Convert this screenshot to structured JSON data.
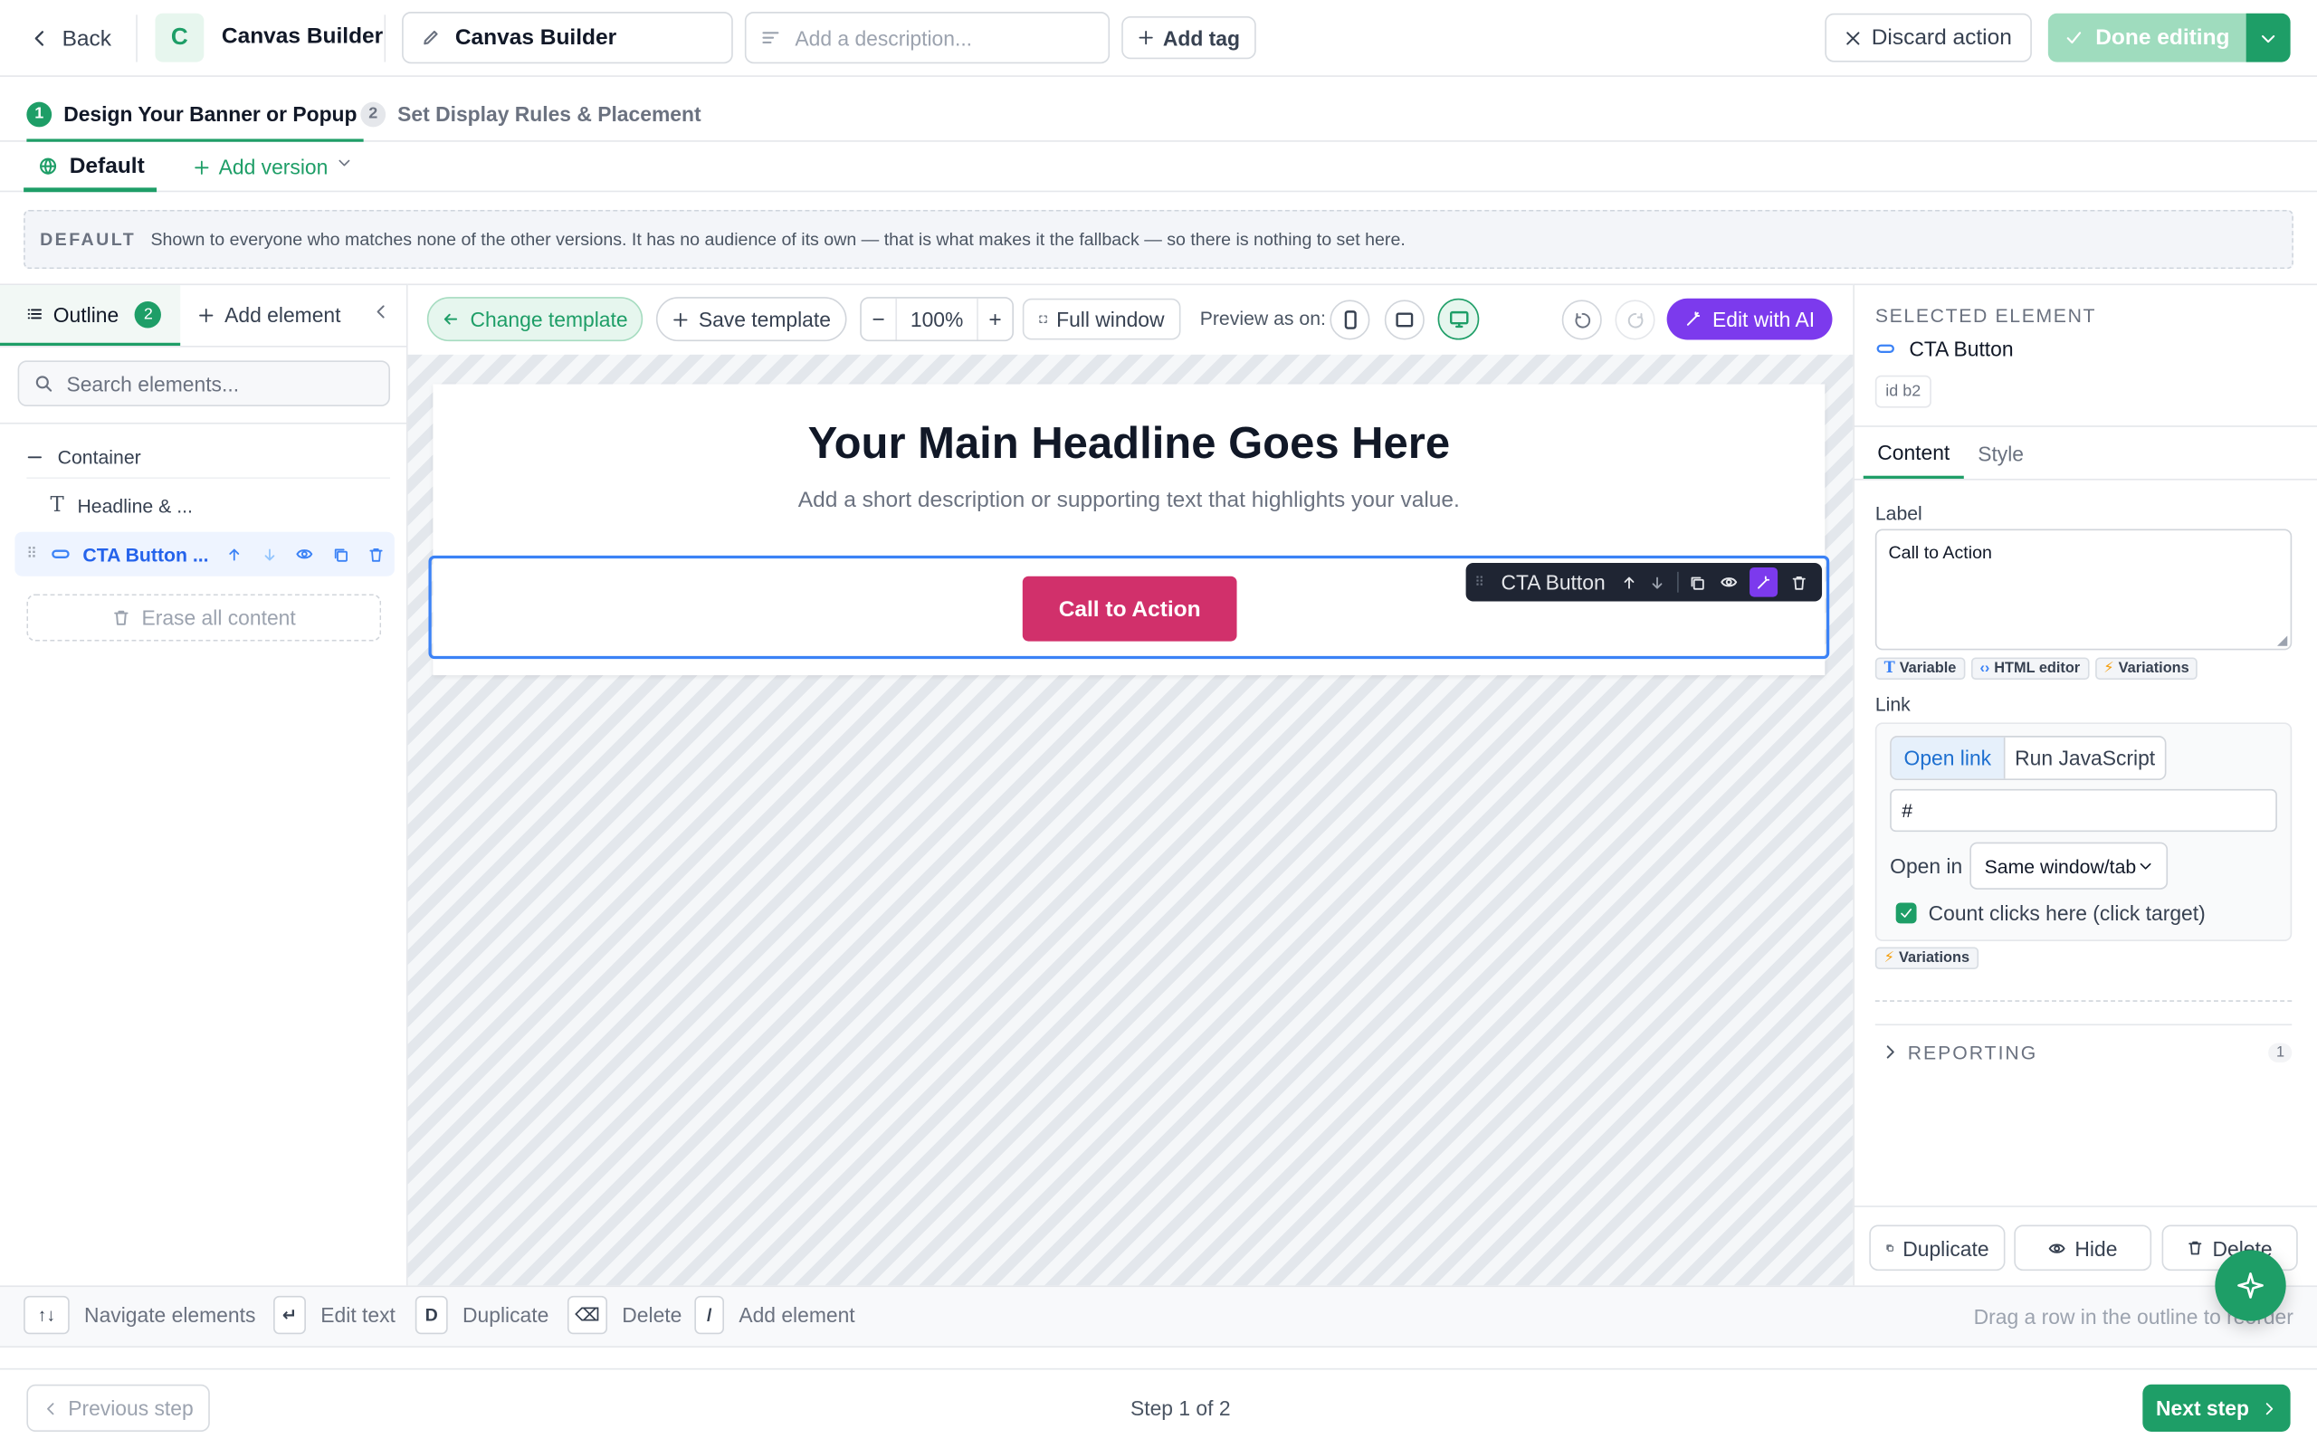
{
  "topbar": {
    "back_label": "Back",
    "app_initial": "C",
    "app_name": "Canvas Builder",
    "title_value": "Canvas Builder",
    "description_placeholder": "Add a description...",
    "add_tag_label": "Add tag",
    "discard_label": "Discard action",
    "done_label": "Done editing"
  },
  "steps": [
    {
      "number": "1",
      "label": "Design Your Banner or Popup",
      "active": true
    },
    {
      "number": "2",
      "label": "Set Display Rules & Placement",
      "active": false
    }
  ],
  "versions": {
    "default_label": "Default",
    "add_label": "Add version"
  },
  "default_banner": {
    "tag": "DEFAULT",
    "text": "Shown to everyone who matches none of the other versions. It has no audience of its own — that is what makes it the fallback — so there is nothing to set here."
  },
  "left_panel": {
    "outline_label": "Outline",
    "outline_count": "2",
    "add_element_label": "Add element",
    "search_placeholder": "Search elements...",
    "tree": {
      "container": "Container",
      "headline": "Headline & ...",
      "cta": "CTA Button ..."
    },
    "erase_label": "Erase all content"
  },
  "canvas_toolbar": {
    "change_template": "Change template",
    "save_template": "Save template",
    "zoom": "100%",
    "full_window": "Full window",
    "preview_label": "Preview as on:",
    "edit_ai": "Edit with AI"
  },
  "canvas": {
    "headline": "Your Main Headline Goes Here",
    "subtext": "Add a short description or supporting text that highlights your value.",
    "cta_label": "Call to Action",
    "floating_toolbar_label": "CTA Button"
  },
  "right_panel": {
    "section_label": "SELECTED ELEMENT",
    "element_name": "CTA Button",
    "element_id": "id b2",
    "tabs": [
      "Content",
      "Style"
    ],
    "label_title": "Label",
    "label_value": "Call to Action",
    "label_chips": [
      "Variable",
      "HTML editor",
      "Variations"
    ],
    "link_title": "Link",
    "link_modes": [
      "Open link",
      "Run JavaScript"
    ],
    "link_value": "#",
    "open_in_label": "Open in",
    "open_in_value": "Same window/tab",
    "count_clicks_label": "Count clicks here (click target)",
    "count_clicks_checked": true,
    "variations_chip": "Variations",
    "reporting_label": "REPORTING",
    "reporting_count": "1",
    "footer_buttons": [
      "Duplicate",
      "Hide",
      "Delete"
    ]
  },
  "shortcuts": [
    {
      "key": "↑↓",
      "label": "Navigate elements"
    },
    {
      "key": "↵",
      "label": "Edit text"
    },
    {
      "key": "D",
      "label": "Duplicate"
    },
    {
      "key": "⌫",
      "label": "Delete"
    },
    {
      "key": "/",
      "label": "Add element"
    }
  ],
  "shortcuts_hint": "Drag a row in the outline to reorder",
  "footer": {
    "prev_label": "Previous step",
    "step_text": "Step 1 of 2",
    "next_label": "Next step"
  },
  "colors": {
    "accent_green": "#1e9e67",
    "cta_pink": "#d1306b",
    "ai_purple": "#7c3aed",
    "selection_blue": "#3b82f6"
  }
}
